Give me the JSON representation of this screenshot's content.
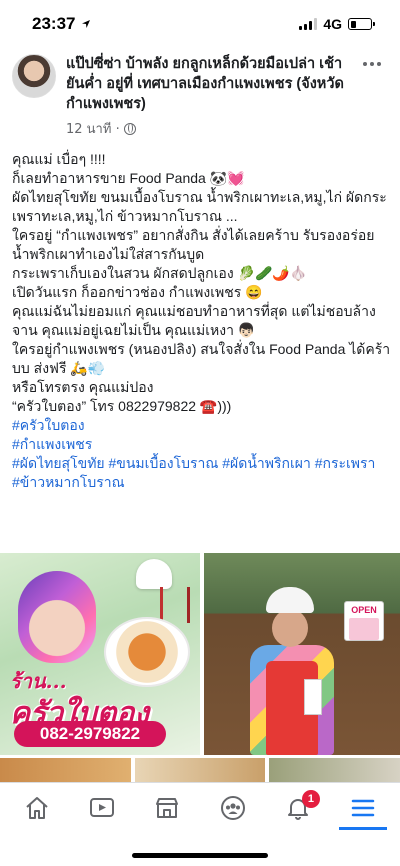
{
  "status_bar": {
    "time": "23:37",
    "network": "4G",
    "battery_level": 0.3
  },
  "post": {
    "author": "แป๊ปซี่ซ่า บ้าพลัง ยกลูกเหล็กด้วยมือเปล่า เช้ายันค่ำ อยู่ที่ เทศบาลเมืองกำแพงเพชร (จังหวัดกำแพงเพชร)",
    "timestamp": "12 นาที ·",
    "privacy_icon": "globe-icon",
    "more_icon": "more-options-icon",
    "lines": [
      "คุณแม่ เบื่อๆ  !!!!",
      "ก็เลยทำอาหารขาย Food Panda 🐼💓",
      "ผัดไทยสุโขทัย ขนมเบื้องโบราณ น้ำพริกเผาทะเล,หมู,ไก่  ผัดกระเพราทะเล,หมู,ไก่  ข้าวหมากโบราณ ...",
      "ใครอยู่ “กำแพงเพชร” อยากสั่งกิน สั่งได้เลยคร้าบ รับรองอร่อย น้ำพริกเผาทำเองไม่ใส่สารกันบูด",
      "กระเพราเก็บเองในสวน ผักสดปลูกเอง  🥬🥒🌶️🧄",
      "เปิดวันแรก ก็ออกข่าวช่อง กำแพงเพชร  😄",
      "คุณแม่ฉันไม่ยอมแก่ คุณแม่ชอบทำอาหารที่สุด แต่ไม่ชอบล้างจาน คุณแม่อยู่เฉยไม่เป็น คุณแม่เหงา 👦🏻",
      "ใครอยู่กำแพงเพชร (หนองปลิง) สนใจสั่งใน Food Panda ได้คร้าบบ ส่งฟรี  🛵💨",
      "หรือโทรตรง คุณแม่ปอง",
      "“ครัวใบตอง” โทร 0822979822  ☎️)))"
    ],
    "hashtags": [
      "#ครัวใบตอง",
      "#กำแพงเพชร",
      "#ผัดไทยสุโขทัย #ขนมเบื้องโบราณ #ผัดน้ำพริกเผา #กระเพรา",
      "#ข้าวหมากโบราณ"
    ]
  },
  "photos": {
    "left_sign_small": "ร้าน...",
    "left_sign_big": "ครัวใบตอง",
    "left_phone": "082-2979822",
    "right_open_sign": "OPEN"
  },
  "tabbar": {
    "tabs": [
      {
        "name": "home-tab",
        "icon": "home-icon"
      },
      {
        "name": "watch-tab",
        "icon": "video-icon"
      },
      {
        "name": "marketplace-tab",
        "icon": "shop-icon"
      },
      {
        "name": "groups-tab",
        "icon": "groups-icon"
      },
      {
        "name": "notifications-tab",
        "icon": "bell-icon",
        "badge": "1"
      },
      {
        "name": "menu-tab",
        "icon": "menu-icon"
      }
    ],
    "notification_badge": "1"
  },
  "colors": {
    "link": "#1d66d6",
    "accent": "#1877f2",
    "badge": "#e41e3f",
    "brand_pink": "#d4145a"
  }
}
